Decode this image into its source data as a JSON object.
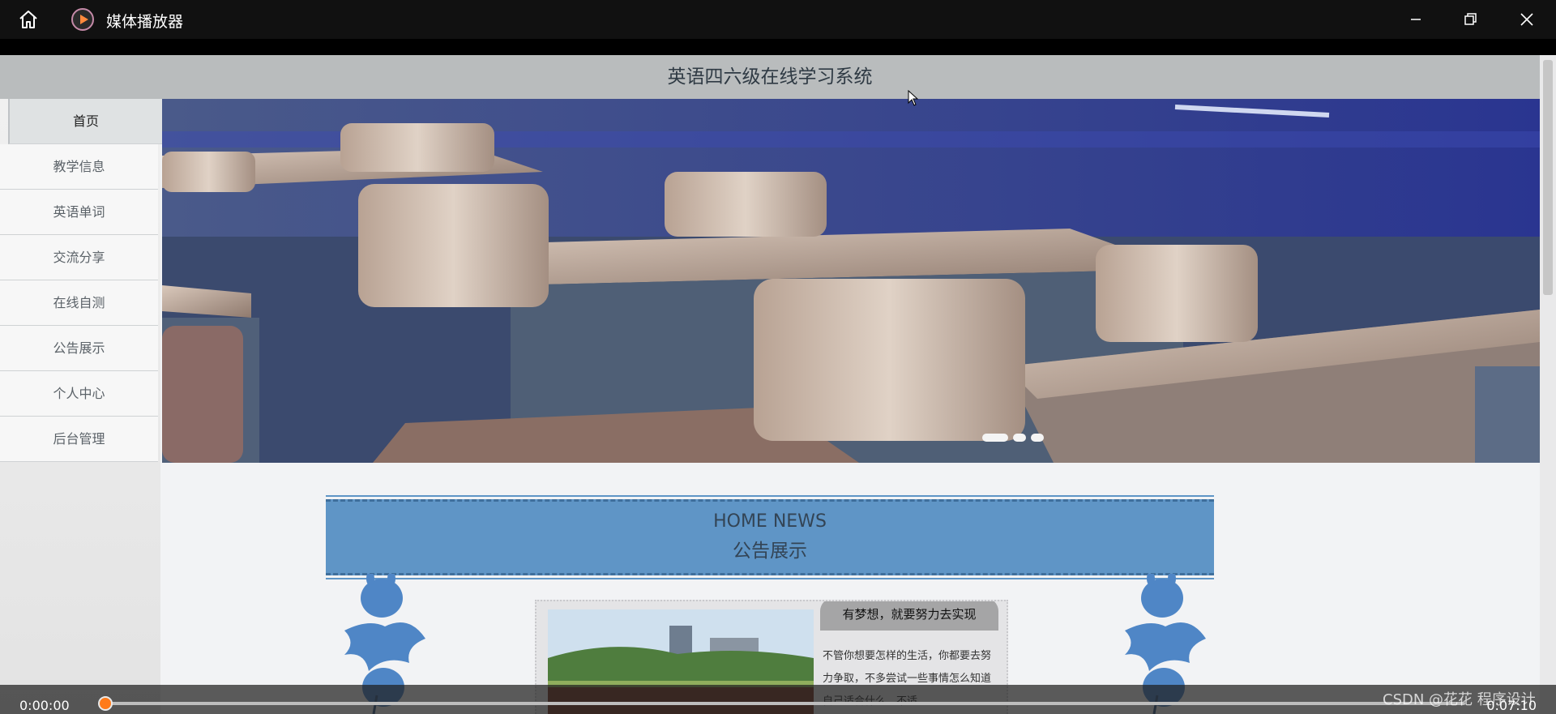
{
  "player": {
    "app_title": "媒体播放器",
    "time_current": "0:00:00",
    "time_total": "0:07:10",
    "progress_fraction": 0.0,
    "accent_color": "#ff7a1a",
    "watermark": "CSDN @花花 程序设计"
  },
  "site": {
    "title": "英语四六级在线学习系统",
    "nav": [
      {
        "label": "首页",
        "active": true
      },
      {
        "label": "教学信息",
        "active": false
      },
      {
        "label": "英语单词",
        "active": false
      },
      {
        "label": "交流分享",
        "active": false
      },
      {
        "label": "在线自测",
        "active": false
      },
      {
        "label": "公告展示",
        "active": false
      },
      {
        "label": "个人中心",
        "active": false
      },
      {
        "label": "后台管理",
        "active": false
      }
    ],
    "carousel": {
      "slide_count": 3,
      "active_slide": 1
    },
    "news": {
      "heading_en": "HOME NEWS",
      "heading_cn": "公告展示",
      "card_title": "有梦想，就要努力去实现",
      "card_text": "不管你想要怎样的生活，你都要去努力争取，不多尝试一些事情怎么知道自己适合什么、不适"
    }
  }
}
